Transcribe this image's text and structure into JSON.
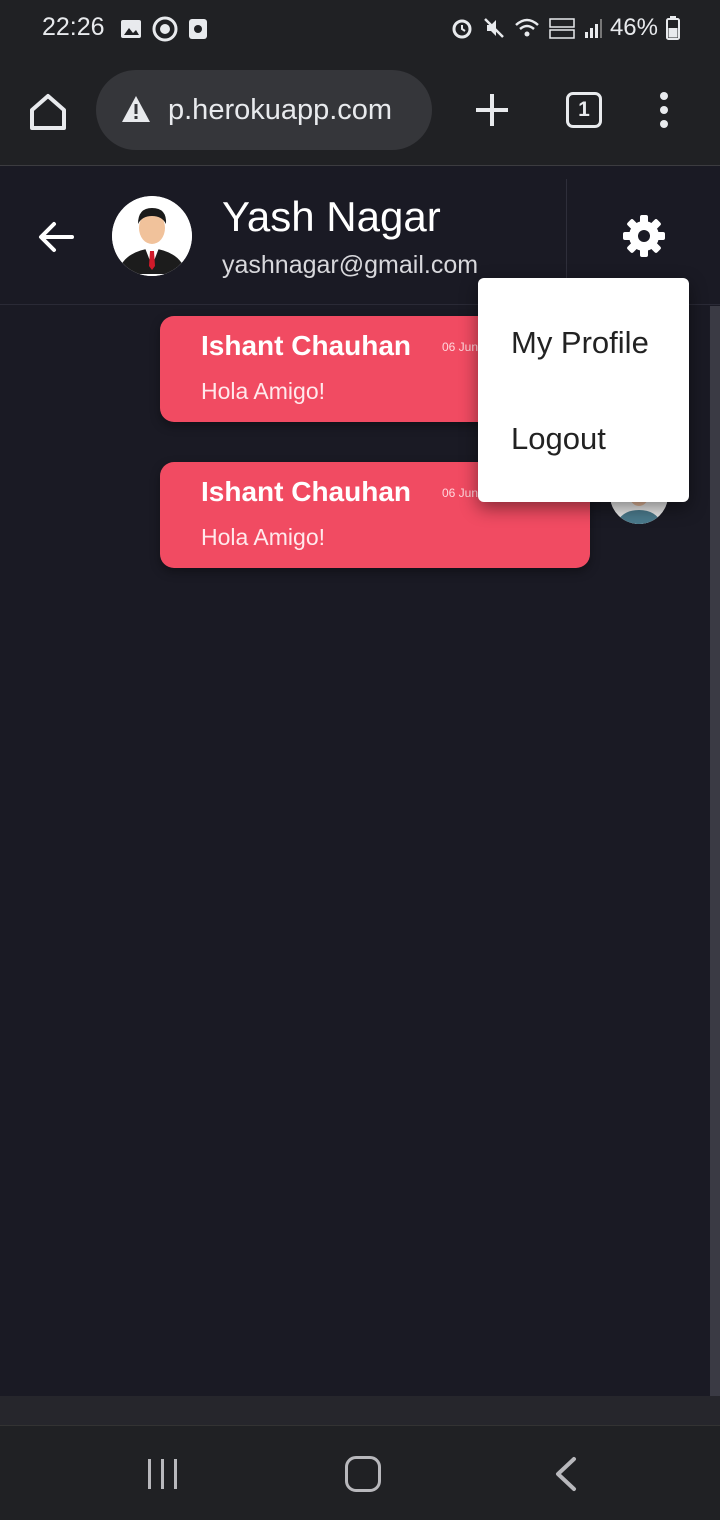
{
  "status_bar": {
    "time": "22:26",
    "battery": "46%",
    "icons_left": [
      "gallery-icon",
      "sync-icon",
      "record-icon"
    ],
    "icons_right": [
      "alarm-icon",
      "mute-icon",
      "wifi-icon",
      "volte-lte2-icon",
      "signal-icon",
      "battery-icon"
    ]
  },
  "browser": {
    "url": "p.herokuapp.com",
    "tab_count": "1"
  },
  "chat_header": {
    "name": "Yash Nagar",
    "email": "yashnagar@gmail.com"
  },
  "messages": [
    {
      "sender": "Ishant Chauhan",
      "time": "06 Jun",
      "text": "Hola Amigo!"
    },
    {
      "sender": "Ishant Chauhan",
      "time": "06 Jun",
      "text": "Hola Amigo!"
    }
  ],
  "dropdown": {
    "items": [
      {
        "label": "My Profile"
      },
      {
        "label": "Logout"
      }
    ]
  },
  "colors": {
    "bubble": "#f14b62",
    "background": "#1a1a24",
    "browser_chrome": "#202124"
  }
}
